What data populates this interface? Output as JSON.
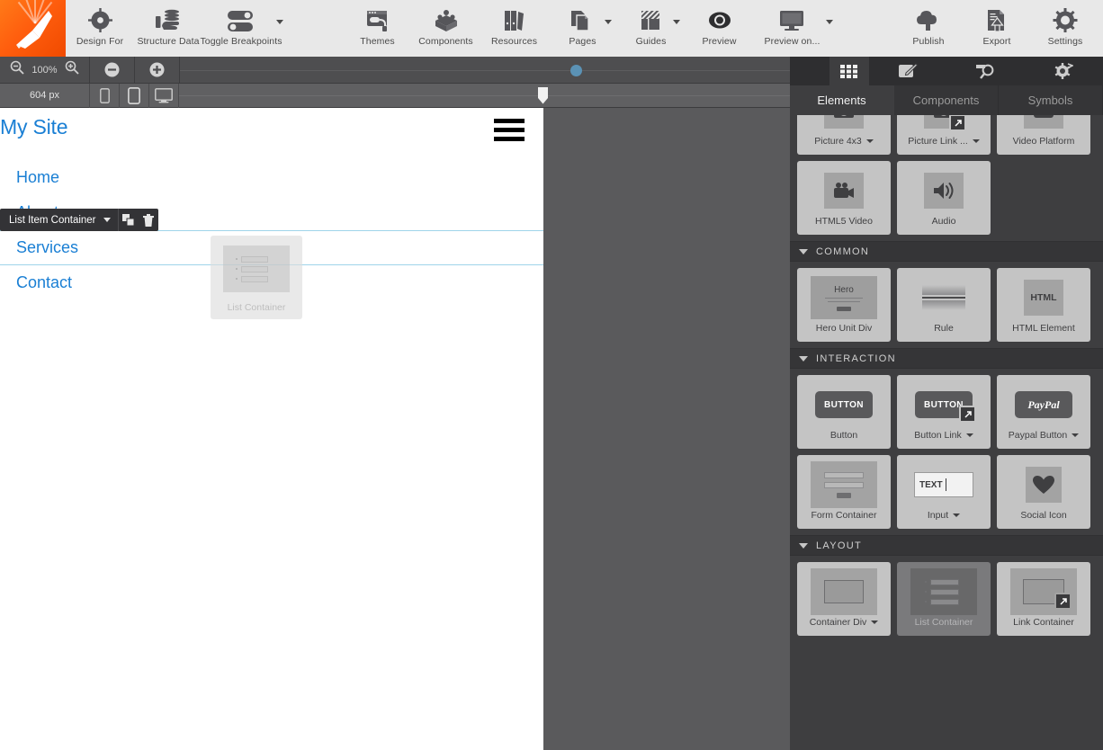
{
  "toolbar": {
    "logo_icon": "pen-nib-logo-icon",
    "items": [
      {
        "label": "Design For",
        "icon": "design-for-target-icon",
        "caret": false
      },
      {
        "label": "Structure Data",
        "icon": "structure-data-hand-layers-icon",
        "caret": false
      },
      {
        "label": "Toggle Breakpoints",
        "icon": "toggle-breakpoints-switches-icon",
        "caret": true
      }
    ],
    "center_items": [
      {
        "label": "Themes",
        "icon": "themes-paint-roller-icon",
        "caret": false
      },
      {
        "label": "Components",
        "icon": "components-cube-icon",
        "caret": false
      },
      {
        "label": "Resources",
        "icon": "resources-books-icon",
        "caret": false
      },
      {
        "label": "Pages",
        "icon": "pages-documents-icon",
        "caret": true
      },
      {
        "label": "Guides",
        "icon": "guides-hatched-square-icon",
        "caret": true
      },
      {
        "label": "Preview",
        "icon": "preview-eye-icon",
        "caret": false
      },
      {
        "label": "Preview on...",
        "icon": "preview-on-monitor-icon",
        "caret": true
      }
    ],
    "right_items": [
      {
        "label": "Publish",
        "icon": "publish-cloud-upload-icon",
        "caret": false
      },
      {
        "label": "Export",
        "icon": "export-document-upload-icon",
        "caret": false
      },
      {
        "label": "Settings",
        "icon": "settings-gear-icon",
        "caret": false
      }
    ]
  },
  "zoombar": {
    "zoom_out_icon": "zoom-out-icon",
    "zoom_level": "100%",
    "zoom_in_icon": "zoom-in-icon",
    "minus_icon": "minus-circle-icon",
    "plus_icon": "plus-circle-icon",
    "breakpoint_dot_color": "#5b92b5"
  },
  "devicebar": {
    "width_label": "604 px",
    "devices": [
      {
        "icon": "phone-portrait-icon"
      },
      {
        "icon": "tablet-portrait-icon"
      },
      {
        "icon": "desktop-monitor-icon"
      }
    ]
  },
  "canvas": {
    "site_title": "My Site",
    "menu_icon": "hamburger-menu-icon",
    "nav_items": [
      {
        "label": "Home",
        "selected": false
      },
      {
        "label": "About",
        "selected": false
      },
      {
        "label": "Services",
        "selected": true
      },
      {
        "label": "Contact",
        "selected": false
      }
    ],
    "selection_badge": {
      "label": "List Item Container",
      "caret_icon": "chevron-down-icon",
      "duplicate_icon": "duplicate-icon",
      "delete_icon": "trash-icon"
    },
    "drag_ghost": {
      "label": "List Container"
    },
    "selection_color": "#9fd4ea",
    "link_color": "#1a7fd4"
  },
  "panel": {
    "icon_tabs": [
      {
        "icon": "elements-grid-icon",
        "active": true
      },
      {
        "icon": "edit-pencil-icon",
        "active": false
      },
      {
        "icon": "inspect-magnifier-icon",
        "active": false
      },
      {
        "icon": "settings-gear-icon",
        "active": false
      }
    ],
    "text_tabs": [
      {
        "label": "Elements",
        "active": true
      },
      {
        "label": "Components",
        "active": false
      },
      {
        "label": "Symbols",
        "active": false
      }
    ],
    "media_tiles": [
      {
        "label": "Picture 4x3",
        "icon": "camera-icon",
        "caret": true,
        "link_badge": false
      },
      {
        "label": "Picture Link ...",
        "icon": "camera-icon",
        "caret": true,
        "link_badge": true
      },
      {
        "label": "Video Platform",
        "icon": "video-play-icon",
        "caret": false,
        "link_badge": false
      },
      {
        "label": "HTML5 Video",
        "icon": "video-camera-icon",
        "caret": false,
        "link_badge": false
      },
      {
        "label": "Audio",
        "icon": "speaker-icon",
        "caret": false,
        "link_badge": false
      }
    ],
    "sections": [
      {
        "title": "COMMON",
        "tiles": [
          {
            "label": "Hero Unit Div",
            "thumb": "hero-thumb",
            "caret": false,
            "text": "Hero",
            "dragging": false
          },
          {
            "label": "Rule",
            "thumb": "rule-thumb",
            "caret": false,
            "dragging": false
          },
          {
            "label": "HTML Element",
            "thumb": "html-thumb",
            "caret": false,
            "text": "HTML",
            "dragging": false
          }
        ]
      },
      {
        "title": "INTERACTION",
        "tiles": [
          {
            "label": "Button",
            "thumb": "button-thumb",
            "caret": false,
            "text": "BUTTON",
            "dragging": false
          },
          {
            "label": "Button Link",
            "thumb": "button-link-thumb",
            "caret": true,
            "text": "BUTTON",
            "dragging": false
          },
          {
            "label": "Paypal Button",
            "thumb": "paypal-thumb",
            "caret": true,
            "text": "PayPal",
            "dragging": false
          },
          {
            "label": "Form Container",
            "thumb": "form-thumb",
            "caret": false,
            "dragging": false
          },
          {
            "label": "Input",
            "thumb": "input-thumb",
            "caret": true,
            "text": "TEXT",
            "dragging": false
          },
          {
            "label": "Social Icon",
            "thumb": "heart-thumb",
            "caret": false,
            "dragging": false
          }
        ]
      },
      {
        "title": "LAYOUT",
        "tiles": [
          {
            "label": "Container Div",
            "thumb": "container-thumb",
            "caret": true,
            "dragging": false
          },
          {
            "label": "List Container",
            "thumb": "list-thumb",
            "caret": false,
            "dragging": true
          },
          {
            "label": "Link Container",
            "thumb": "link-container-thumb",
            "caret": false,
            "dragging": false
          }
        ]
      }
    ]
  }
}
